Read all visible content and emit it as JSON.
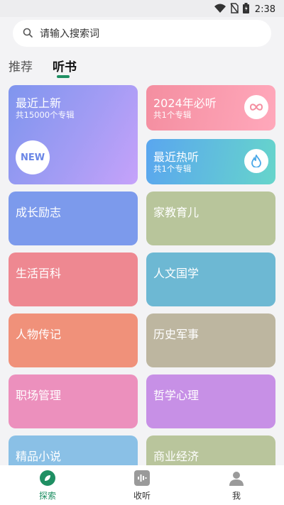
{
  "status_bar": {
    "time": "2:38",
    "icons": [
      "wifi-icon",
      "no-sim-icon",
      "battery-icon"
    ]
  },
  "search": {
    "placeholder": "请输入搜索词",
    "icon": "search-icon"
  },
  "tabs": [
    {
      "label": "推荐"
    },
    {
      "label": "听书",
      "active": true
    }
  ],
  "featured": {
    "latest": {
      "title": "最近上新",
      "subtitle": "共15000个专辑",
      "badge": "NEW",
      "color": "#8f9cf1"
    },
    "y2024": {
      "title": "2024年必听",
      "subtitle": "共1个专辑",
      "icon": "infinity-icon",
      "color": "#f7879c"
    },
    "hot": {
      "title": "最近热听",
      "subtitle": "共1个专辑",
      "icon": "flame-icon",
      "color": "#5eb5e4"
    }
  },
  "categories": [
    {
      "label": "成长励志",
      "color": "#7c9aec"
    },
    {
      "label": "家教育儿",
      "color": "#b8c59b"
    },
    {
      "label": "生活百科",
      "color": "#ee8891"
    },
    {
      "label": "人文国学",
      "color": "#6db8d3"
    },
    {
      "label": "人物传记",
      "color": "#f0917a"
    },
    {
      "label": "历史军事",
      "color": "#bdb6a0"
    },
    {
      "label": "职场管理",
      "color": "#ec90bd"
    },
    {
      "label": "哲学心理",
      "color": "#c790e6"
    },
    {
      "label": "精品小说",
      "color": "#8ac0e6"
    },
    {
      "label": "商业经济",
      "color": "#b9c59c"
    }
  ],
  "bottom_nav": [
    {
      "label": "探索",
      "icon": "leaf-icon",
      "active": true,
      "color": "#1f8f63"
    },
    {
      "label": "收听",
      "icon": "audio-wave-icon",
      "color": "#999999"
    },
    {
      "label": "我",
      "icon": "person-icon",
      "color": "#999999"
    }
  ]
}
